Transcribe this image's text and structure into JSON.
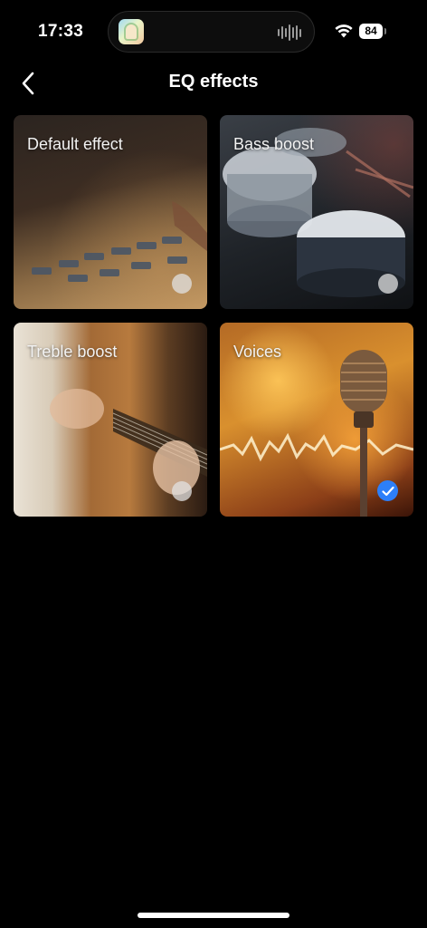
{
  "status_bar": {
    "time": "17:33",
    "battery": "84"
  },
  "header": {
    "title": "EQ effects"
  },
  "effects": [
    {
      "label": "Default effect",
      "selected": false
    },
    {
      "label": "Bass boost",
      "selected": false
    },
    {
      "label": "Treble boost",
      "selected": false
    },
    {
      "label": "Voices",
      "selected": true
    }
  ],
  "colors": {
    "background": "#000000",
    "accent": "#2d7ff9"
  },
  "icons": {
    "back": "chevron-left-icon",
    "check": "checkmark-icon",
    "wifi": "wifi-icon"
  }
}
